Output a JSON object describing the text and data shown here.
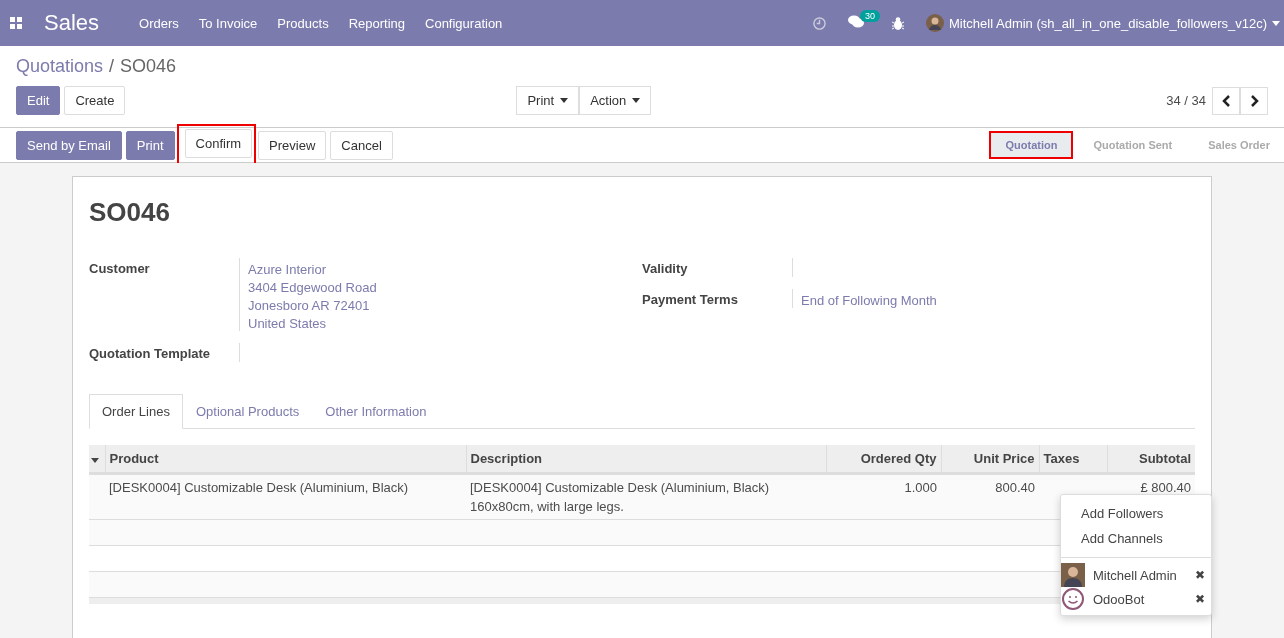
{
  "navbar": {
    "app": "Sales",
    "menu": [
      "Orders",
      "To Invoice",
      "Products",
      "Reporting",
      "Configuration"
    ],
    "messages_badge": "30",
    "user": "Mitchell Admin (sh_all_in_one_disable_followers_v12c)"
  },
  "breadcrumb": {
    "parent": "Quotations",
    "separator": "/",
    "current": "SO046"
  },
  "control_buttons": [
    {
      "label": "Edit",
      "kind": "primary"
    },
    {
      "label": "Create",
      "kind": "secondary"
    }
  ],
  "dropdowns": [
    "Print",
    "Action"
  ],
  "pager": "34 / 34",
  "action_buttons": [
    {
      "label": "Send by Email",
      "kind": "primary",
      "highlighted": false
    },
    {
      "label": "Print",
      "kind": "primary",
      "highlighted": false
    },
    {
      "label": "Confirm",
      "kind": "secondary",
      "highlighted": true
    },
    {
      "label": "Preview",
      "kind": "secondary",
      "highlighted": false
    },
    {
      "label": "Cancel",
      "kind": "secondary",
      "highlighted": false
    }
  ],
  "stages": [
    {
      "label": "Quotation",
      "selected": true,
      "highlighted": true
    },
    {
      "label": "Quotation Sent",
      "selected": false,
      "highlighted": false
    },
    {
      "label": "Sales Order",
      "selected": false,
      "highlighted": false
    }
  ],
  "title": "SO046",
  "left_fields": [
    {
      "label": "Customer",
      "lines": [
        "Azure Interior",
        "3404 Edgewood Road",
        "Jonesboro AR 72401",
        "United States"
      ]
    },
    {
      "label": "Quotation Template"
    }
  ],
  "right_fields": [
    {
      "label": "Validity"
    },
    {
      "label": "Payment Terms",
      "lines": [
        "End of Following Month"
      ]
    }
  ],
  "tabs": [
    {
      "label": "Order Lines",
      "selected": true
    },
    {
      "label": "Optional Products",
      "selected": false
    },
    {
      "label": "Other Information",
      "selected": false
    }
  ],
  "table": {
    "columns": [
      {
        "label": "Product",
        "kind": "text"
      },
      {
        "label": "Description",
        "kind": "text"
      },
      {
        "label": "Ordered Qty",
        "kind": "number"
      },
      {
        "label": "Unit Price",
        "kind": "number"
      },
      {
        "label": "Taxes",
        "kind": "text"
      },
      {
        "label": "Subtotal",
        "kind": "number"
      }
    ],
    "rows": [
      [
        "[DESK0004] Customizable Desk (Aluminium, Black)",
        "[DESK0004] Customizable Desk (Aluminium, Black)\n160x80cm, with large legs.",
        "1.000",
        "800.40",
        "",
        "£ 800.40"
      ]
    ]
  },
  "followers_menu": {
    "actions": [
      "Add Followers",
      "Add Channels"
    ],
    "followers": [
      {
        "name": "Mitchell Admin",
        "kind": "user"
      },
      {
        "name": "OdooBot",
        "kind": "bot"
      }
    ],
    "remove": "✖"
  }
}
